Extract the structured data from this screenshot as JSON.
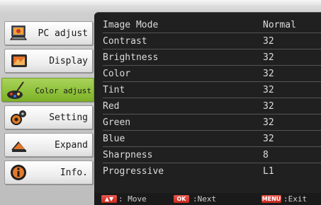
{
  "sidebar": {
    "items": [
      {
        "label": "PC adjust",
        "icon": "pc-adjust-icon",
        "active": false
      },
      {
        "label": "Display",
        "icon": "display-icon",
        "active": false
      },
      {
        "label": "Color adjust",
        "icon": "color-adjust-icon",
        "active": true
      },
      {
        "label": "Setting",
        "icon": "setting-icon",
        "active": false
      },
      {
        "label": "Expand",
        "icon": "expand-icon",
        "active": false
      },
      {
        "label": "Info.",
        "icon": "info-icon",
        "active": false
      }
    ]
  },
  "menu": {
    "rows": [
      {
        "name": "Image Mode",
        "value": "Normal"
      },
      {
        "name": "Contrast",
        "value": "32"
      },
      {
        "name": "Brightness",
        "value": "32"
      },
      {
        "name": "Color",
        "value": "32"
      },
      {
        "name": "Tint",
        "value": "32"
      },
      {
        "name": "Red",
        "value": "32"
      },
      {
        "name": "Green",
        "value": "32"
      },
      {
        "name": "Blue",
        "value": "32"
      },
      {
        "name": "Sharpness",
        "value": "8"
      },
      {
        "name": "Progressive",
        "value": "L1"
      }
    ]
  },
  "footer": {
    "move_key": "▲▼",
    "move_label": ": Move",
    "next_key": "OK",
    "next_label": ":Next",
    "exit_key": "MENU",
    "exit_label": ":Exit"
  },
  "colors": {
    "active_item": "#8ec03a",
    "panel_bg": "#202020",
    "key_red": "#c6291f"
  }
}
